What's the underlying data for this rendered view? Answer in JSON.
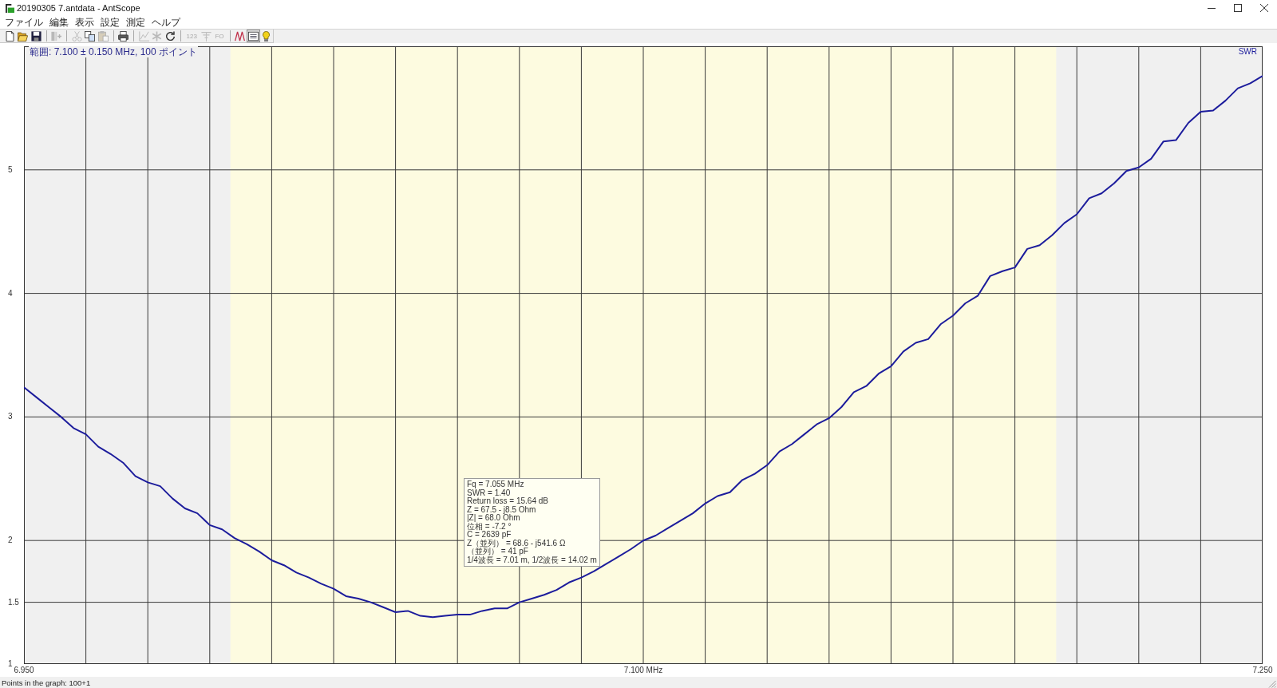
{
  "window": {
    "title": "20190305 7.antdata - AntScope"
  },
  "menu": [
    "ファイル",
    "編集",
    "表示",
    "設定",
    "測定",
    "ヘルプ"
  ],
  "toolbar": {
    "groups": [
      [
        {
          "kind": "new",
          "disabled": false,
          "pressed": false
        },
        {
          "kind": "open",
          "disabled": false,
          "pressed": false
        },
        {
          "kind": "save",
          "disabled": false,
          "pressed": false
        }
      ],
      [
        {
          "kind": "columns",
          "disabled": true,
          "pressed": false
        }
      ],
      [
        {
          "kind": "cut",
          "disabled": true,
          "pressed": false
        },
        {
          "kind": "copy",
          "disabled": false,
          "pressed": false
        },
        {
          "kind": "paste",
          "disabled": true,
          "pressed": false
        }
      ],
      [
        {
          "kind": "print",
          "disabled": false,
          "pressed": false
        }
      ],
      [
        {
          "kind": "chart",
          "disabled": true,
          "pressed": false
        },
        {
          "kind": "asterisk",
          "disabled": true,
          "pressed": false
        },
        {
          "kind": "refresh",
          "disabled": false,
          "pressed": false
        }
      ],
      [
        {
          "kind": "text",
          "label": "123",
          "disabled": true,
          "pressed": false
        },
        {
          "kind": "antenna",
          "disabled": true,
          "pressed": false
        },
        {
          "kind": "text",
          "label": "FO",
          "disabled": true,
          "pressed": false
        }
      ],
      [
        {
          "kind": "zigzag",
          "disabled": false,
          "pressed": false
        },
        {
          "kind": "list",
          "disabled": false,
          "pressed": true
        },
        {
          "kind": "bulb",
          "disabled": false,
          "pressed": false
        }
      ]
    ]
  },
  "plot": {
    "readout": [
      "Fq = 7.055 MHz",
      "SWR = 1.40",
      "Return loss = 15.64 dB",
      "Z = 67.5 - j8.5 Ohm",
      "|Z| = 68.0 Ohm",
      "位相 = -7.2 °",
      "C = 2639 pF",
      "Z（並列） = 68.6 - j541.6 Ω",
      "（並列） = 41 pF",
      "1/4波長 = 7.01 m, 1/2波長 = 14.02 m"
    ],
    "chart_data": {
      "type": "line",
      "title": "範囲: 7.100 ± 0.150 MHz, 100 ポイント",
      "grid": true,
      "xlim": [
        6.95,
        7.25
      ],
      "ylim": [
        1,
        6
      ],
      "xticks": [
        {
          "value": 6.95,
          "label": "6.950"
        },
        {
          "value": 7.1,
          "label": "7.100 MHz"
        },
        {
          "value": 7.25,
          "label": "7.250"
        }
      ],
      "yticks": [
        1,
        1.5,
        2,
        3,
        4,
        5
      ],
      "x": [
        6.95,
        6.953,
        6.956,
        6.959,
        6.962,
        6.965,
        6.968,
        6.971,
        6.974,
        6.977,
        6.98,
        6.983,
        6.986,
        6.989,
        6.992,
        6.995,
        6.998,
        7.001,
        7.004,
        7.007,
        7.01,
        7.013,
        7.016,
        7.019,
        7.022,
        7.025,
        7.028,
        7.031,
        7.034,
        7.037,
        7.04,
        7.043,
        7.046,
        7.049,
        7.052,
        7.055,
        7.058,
        7.061,
        7.064,
        7.067,
        7.07,
        7.073,
        7.076,
        7.079,
        7.082,
        7.085,
        7.088,
        7.091,
        7.094,
        7.097,
        7.1,
        7.103,
        7.106,
        7.109,
        7.112,
        7.115,
        7.118,
        7.121,
        7.124,
        7.127,
        7.13,
        7.133,
        7.136,
        7.139,
        7.142,
        7.145,
        7.148,
        7.151,
        7.154,
        7.157,
        7.16,
        7.163,
        7.166,
        7.169,
        7.172,
        7.175,
        7.178,
        7.181,
        7.184,
        7.187,
        7.19,
        7.193,
        7.196,
        7.199,
        7.202,
        7.205,
        7.208,
        7.211,
        7.214,
        7.217,
        7.22,
        7.223,
        7.226,
        7.229,
        7.232,
        7.235,
        7.238,
        7.241,
        7.244,
        7.247,
        7.25
      ],
      "series": [
        {
          "name": "SWR",
          "color": "#1c1c9c",
          "values": [
            3.24,
            3.16,
            3.08,
            3.0,
            2.91,
            2.86,
            2.76,
            2.7,
            2.63,
            2.52,
            2.47,
            2.44,
            2.34,
            2.26,
            2.22,
            2.125,
            2.09,
            2.02,
            1.97,
            1.91,
            1.84,
            1.8,
            1.74,
            1.7,
            1.65,
            1.61,
            1.55,
            1.53,
            1.5,
            1.46,
            1.42,
            1.43,
            1.39,
            1.38,
            1.39,
            1.4,
            1.4,
            1.43,
            1.45,
            1.45,
            1.5,
            1.53,
            1.56,
            1.6,
            1.66,
            1.7,
            1.75,
            1.81,
            1.87,
            1.93,
            2.0,
            2.04,
            2.1,
            2.16,
            2.22,
            2.3,
            2.36,
            2.39,
            2.49,
            2.54,
            2.61,
            2.72,
            2.78,
            2.86,
            2.94,
            2.99,
            3.08,
            3.2,
            3.25,
            3.35,
            3.41,
            3.53,
            3.6,
            3.63,
            3.75,
            3.82,
            3.92,
            3.98,
            4.14,
            4.18,
            4.21,
            4.36,
            4.39,
            4.47,
            4.57,
            4.64,
            4.77,
            4.81,
            4.89,
            4.99,
            5.02,
            5.09,
            5.23,
            5.24,
            5.38,
            5.47,
            5.48,
            5.56,
            5.66,
            5.7,
            5.76
          ]
        }
      ],
      "bands": [
        {
          "axis": "x",
          "from": 7.0,
          "to": 7.2,
          "color": "#fdfbe0"
        }
      ]
    }
  },
  "status_bar": {
    "text": "Points in the graph: 100+1"
  }
}
